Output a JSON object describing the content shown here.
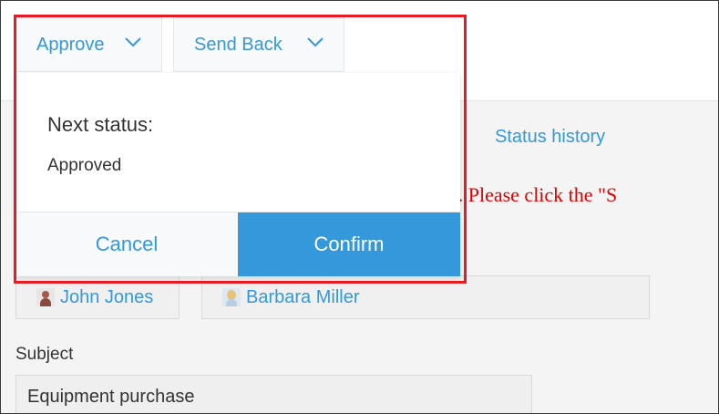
{
  "colors": {
    "accent": "#3498db",
    "highlight": "#e51c23",
    "instruction": "#e00000"
  },
  "toolbar": {
    "approve_label": "Approve",
    "send_back_label": "Send Back",
    "dropdown_icon": "chevron-down-icon"
  },
  "dialog": {
    "next_status_label": "Next status:",
    "next_status_value": "Approved",
    "cancel_label": "Cancel",
    "confirm_label": "Confirm"
  },
  "header": {
    "status_history_label": "Status history"
  },
  "instruction": {
    "visible_text": "t status. Please click the \"S"
  },
  "users": [
    {
      "name": "John Jones",
      "avatar": "male-avatar"
    },
    {
      "name": "Barbara Miller",
      "avatar": "female-avatar"
    }
  ],
  "form": {
    "subject_label": "Subject",
    "subject_value": "Equipment purchase"
  }
}
